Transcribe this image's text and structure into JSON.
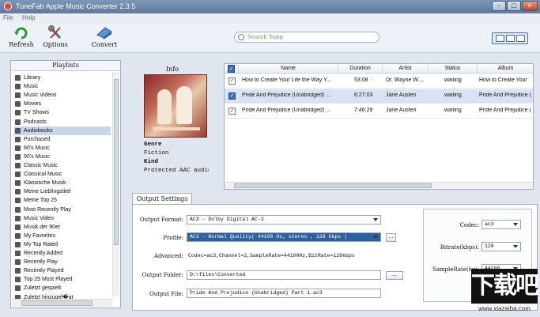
{
  "window": {
    "title": "TuneFab Apple Music Converter 2.3.5",
    "min": "-",
    "max": "□",
    "close": "×"
  },
  "menu": {
    "file": "File",
    "help": "Help"
  },
  "toolbar": {
    "refresh": "Refresh",
    "options": "Options",
    "convert": "Convert"
  },
  "search": {
    "placeholder": "Search Song"
  },
  "playlists": {
    "header": "Playlists",
    "items": [
      "Library",
      "Music",
      "Music Videos",
      "Movies",
      "TV Shows",
      "Podcasts",
      "Audiobooks",
      "Purchased",
      "90's Music",
      "90's Music",
      "Classic Music",
      "Classical Music",
      "Klassische Musik",
      "Meine Lieblingstitel",
      "Meine Top 25",
      "Most Recently Play",
      "Music Video",
      "Musik der 90er",
      "My Favorites",
      "My Top Rated",
      "Recently Added",
      "Recently Play",
      "Recently Played",
      "Top 25 Most Played",
      "Zuletzt gespielt",
      "Zuletzt hinzugef�gt"
    ],
    "selected_index": 6
  },
  "info": {
    "title": "Info",
    "genre_label": "Genre",
    "genre": "Fiction",
    "kind_label": "Kind",
    "kind": "Protected AAC audio"
  },
  "table": {
    "columns": [
      "Name",
      "Duration",
      "Artist",
      "Status",
      "Album"
    ],
    "rows": [
      {
        "name": "How to Create Your Life the Way Y...",
        "duration": "53:08",
        "artist": "Dr. Wayne W....",
        "status": "waiting",
        "album": "How to Create Your",
        "checked": true
      },
      {
        "name": "Pride And Prejudice (Unabridged) ...",
        "duration": "6:27:03",
        "artist": "Jane Austen",
        "status": "waiting",
        "album": "Pride And Prejudice (",
        "checked": true
      },
      {
        "name": "Pride And Prejudice (Unabridged) ...",
        "duration": "7:46:29",
        "artist": "Jane Austen",
        "status": "waiting",
        "album": "Pride And Prejudice (",
        "checked": true
      }
    ],
    "selected_row": 1
  },
  "output": {
    "tab": "Output Settings",
    "format_label": "Output Format:",
    "format": "AC3 - Dolby Digital AC-3",
    "profile_label": "Profile:",
    "profile": "AC3 - Normal Quality( 44100 Hz, stereo , 128 kbps )",
    "profile_btn": "...",
    "advanced_label": "Advanced:",
    "advanced": "Codec=ac3,Channel=2,SampleRate=44100Hz,BitRate=128kbps",
    "folder_label": "Output Folder:",
    "folder": "D:\\files\\Converted",
    "folder_btn": "...",
    "file_label": "Output File:",
    "file": "Pride And Prejudice (Unabridged) Part 1.ac3",
    "codec_label": "Codec:",
    "codec": "ac3",
    "bitrate_label": "Bitrate(kbps):",
    "bitrate": "128",
    "samplerate_label": "SampleRate(hz):",
    "samplerate": "44100"
  },
  "watermark": {
    "big": "下载吧",
    "small": "www.xiazaiba.com"
  }
}
